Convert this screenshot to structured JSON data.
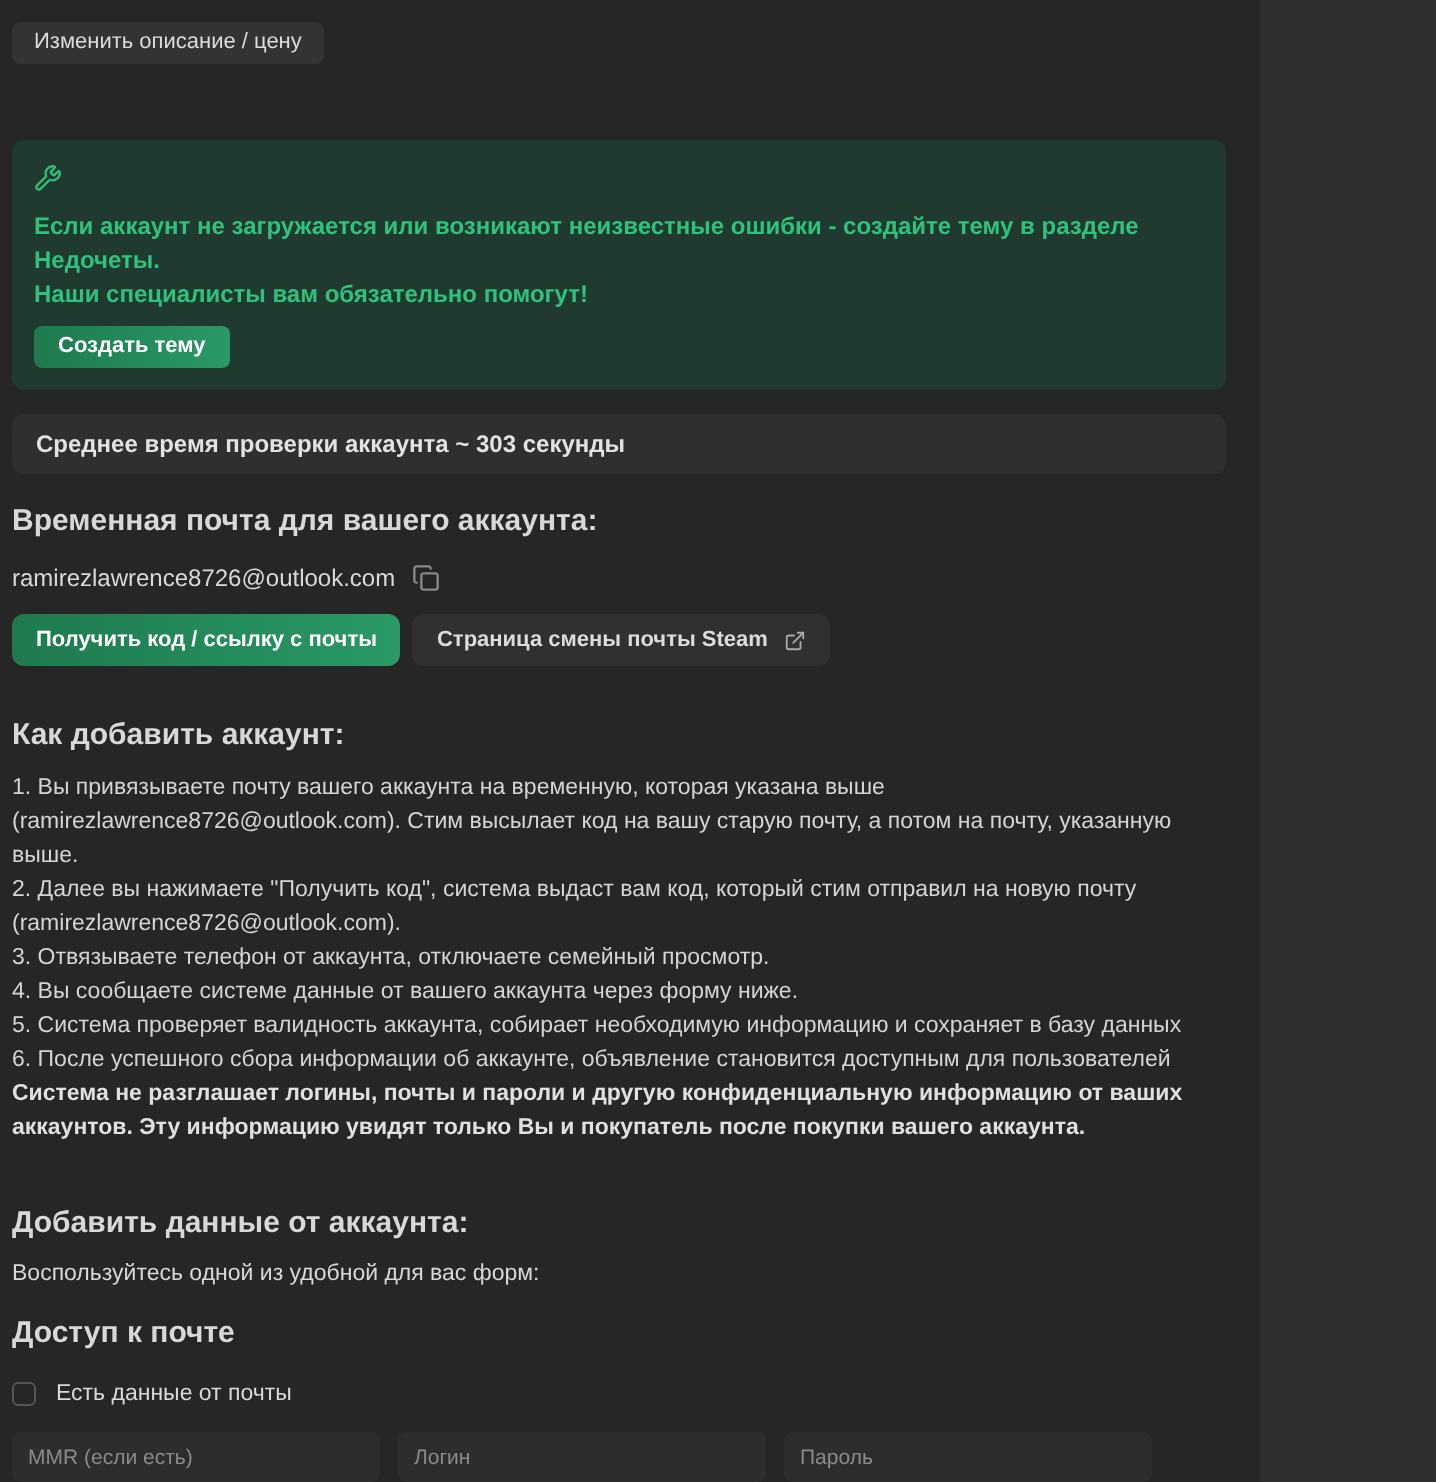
{
  "top_button": "Изменить описание / цену",
  "alert": {
    "lines": [
      "Если аккаунт не загружается или возникают неизвестные ошибки - создайте тему в разделе Недочеты.",
      "Наши специалисты вам обязательно помогут!"
    ],
    "button": "Создать тему"
  },
  "avg_time": "Среднее время проверки аккаунта ~ 303 секунды",
  "temp_mail": {
    "heading": "Временная почта для вашего аккаунта:",
    "email": "ramirezlawrence8726@outlook.com",
    "buttons": [
      {
        "label": "Получить код / ссылку с почты",
        "kind": "primary"
      },
      {
        "label": "Страница смены почты Steam",
        "kind": "external"
      }
    ]
  },
  "howto": {
    "heading": "Как добавить аккаунт:",
    "steps": [
      "1. Вы привязываете почту вашего аккаунта на временную, которая указана выше (ramirezlawrence8726@outlook.com). Стим высылает код на вашу старую почту, а потом на почту, указанную выше.",
      "2. Далее вы нажимаете \"Получить код\", система выдаст вам код, который стим отправил на новую почту (ramirezlawrence8726@outlook.com).",
      "3. Отвязываете телефон от аккаунта, отключаете семейный просмотр.",
      "4. Вы сообщаете системе данные от вашего аккаунта через форму ниже.",
      "5. Система проверяет валидность аккаунта, собирает необходимую информацию и сохраняет в базу данных",
      "6. После успешного сбора информации об аккаунте, объявление становится доступным для пользователей"
    ],
    "note": "Система не разглашает логины, почты и пароли и другую конфиденциальную информацию от ваших аккаунтов. Эту информацию увидят только Вы и покупатель после покупки вашего аккаунта."
  },
  "add_data": {
    "heading": "Добавить данные от аккаунта:",
    "subtitle": "Воспользуйтесь одной из удобной для вас форм:"
  },
  "mail_access": {
    "heading": "Доступ к почте",
    "checkbox": {
      "label": "Есть данные от почты",
      "checked": false
    },
    "fields": [
      {
        "placeholder": "MMR (если есть)"
      },
      {
        "placeholder": "Логин"
      },
      {
        "placeholder": "Пароль"
      }
    ]
  }
}
